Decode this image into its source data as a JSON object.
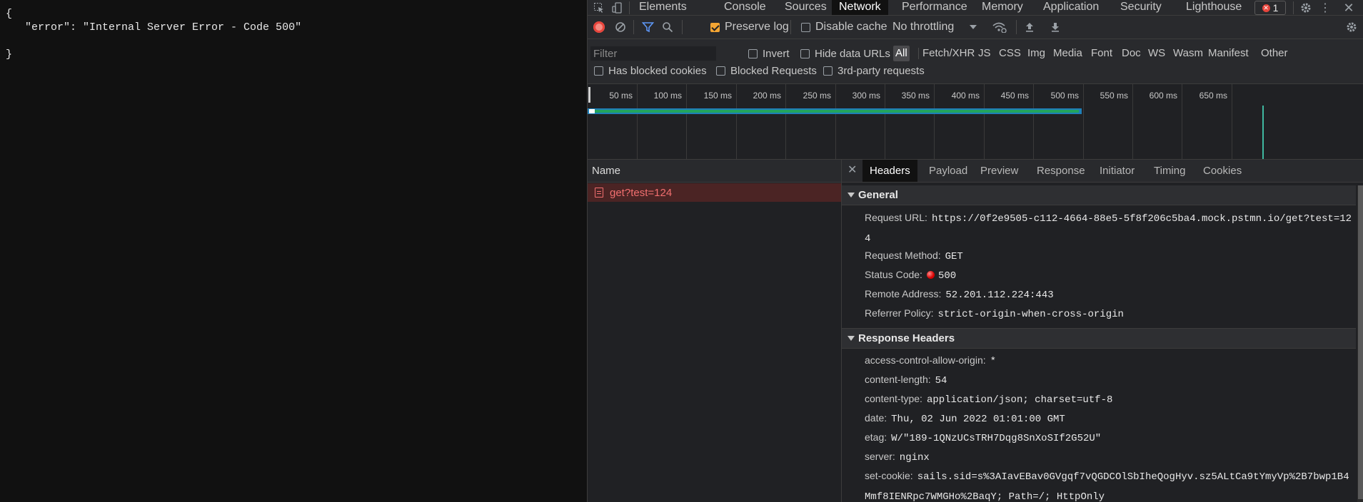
{
  "page": {
    "json_text": "{\n   \"error\": \"Internal Server Error - Code 500\"\n\n}"
  },
  "devtools": {
    "tabs": [
      "Elements",
      "Console",
      "Sources",
      "Network",
      "Performance",
      "Memory",
      "Application",
      "Security",
      "Lighthouse"
    ],
    "active_tab": "Network",
    "error_count": "1",
    "toolbar": {
      "preserve_log": "Preserve log",
      "disable_cache": "Disable cache",
      "throttling": "No throttling"
    },
    "filter": {
      "placeholder": "Filter",
      "invert": "Invert",
      "hide_data_urls": "Hide data URLs",
      "types": [
        "All",
        "Fetch/XHR",
        "JS",
        "CSS",
        "Img",
        "Media",
        "Font",
        "Doc",
        "WS",
        "Wasm",
        "Manifest",
        "Other"
      ],
      "has_blocked_cookies": "Has blocked cookies",
      "blocked_requests": "Blocked Requests",
      "third_party": "3rd-party requests"
    },
    "timeline": {
      "ticks": [
        "50 ms",
        "100 ms",
        "150 ms",
        "200 ms",
        "250 ms",
        "300 ms",
        "350 ms",
        "400 ms",
        "450 ms",
        "500 ms",
        "550 ms",
        "600 ms",
        "650 ms"
      ]
    },
    "requests": {
      "header": "Name",
      "rows": [
        {
          "name": "get?test=124",
          "status": "error"
        }
      ]
    },
    "details": {
      "tabs": [
        "Headers",
        "Payload",
        "Preview",
        "Response",
        "Initiator",
        "Timing",
        "Cookies"
      ],
      "active_tab": "Headers",
      "general_title": "General",
      "general": [
        {
          "k": "Request URL:",
          "v": "https://0f2e9505-c112-4664-88e5-5f8f206c5ba4.mock.pstmn.io/get?test=124"
        },
        {
          "k": "Request Method:",
          "v": "GET"
        },
        {
          "k": "Status Code:",
          "v": "500"
        },
        {
          "k": "Remote Address:",
          "v": "52.201.112.224:443"
        },
        {
          "k": "Referrer Policy:",
          "v": "strict-origin-when-cross-origin"
        }
      ],
      "response_title": "Response Headers",
      "response": [
        {
          "k": "access-control-allow-origin:",
          "v": "*"
        },
        {
          "k": "content-length:",
          "v": "54"
        },
        {
          "k": "content-type:",
          "v": "application/json; charset=utf-8"
        },
        {
          "k": "date:",
          "v": "Thu, 02 Jun 2022 01:01:00 GMT"
        },
        {
          "k": "etag:",
          "v": "W/\"189-1QNzUCsTRH7Dqg8SnXoSIf2G52U\""
        },
        {
          "k": "server:",
          "v": "nginx"
        },
        {
          "k": "set-cookie:",
          "v": "sails.sid=s%3AIavEBav0GVgqf7vQGDCOlSbIheQogHyv.sz5ALtCa9tYmyVp%2B7bwp1B4Mmf8IENRpc7WMGHo%2BaqY; Path=/; HttpOnly"
        }
      ]
    }
  }
}
